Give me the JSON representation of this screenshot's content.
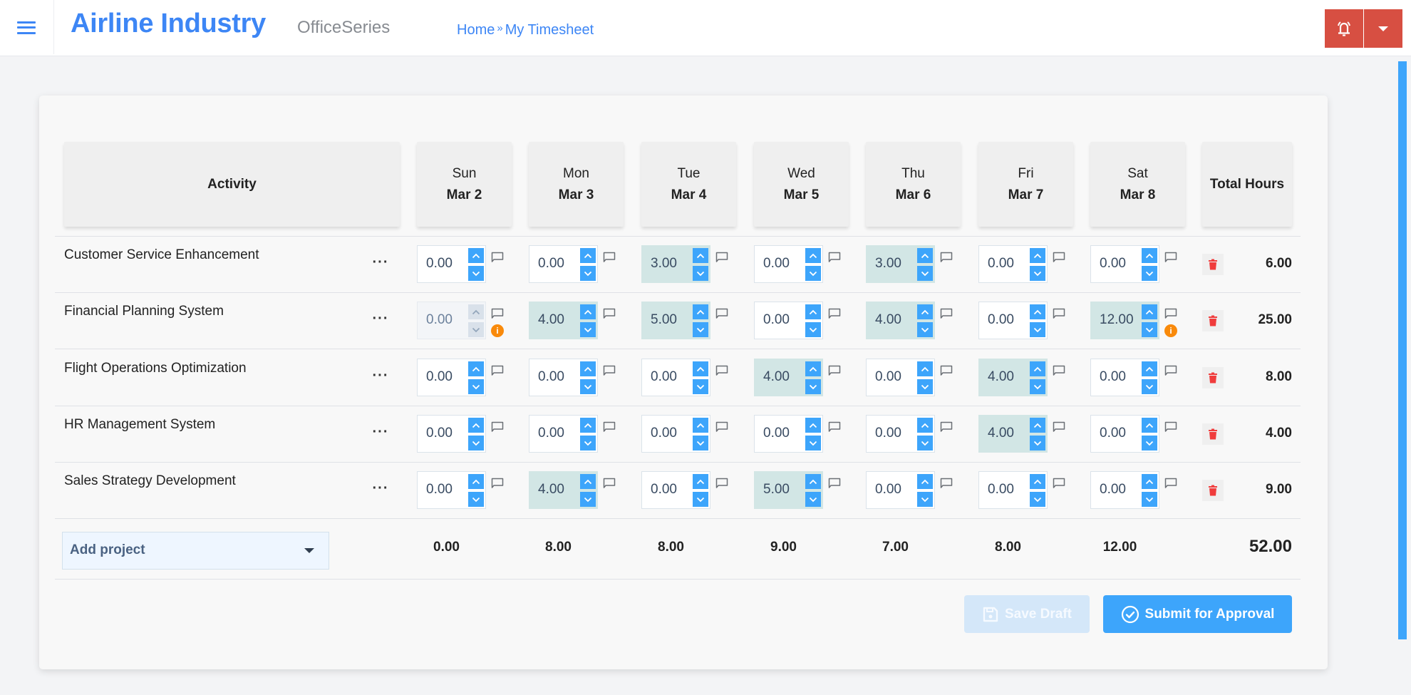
{
  "header": {
    "menu_icon": "hamburger-icon",
    "brand": "Airline Industry",
    "product": "OfficeSeries",
    "breadcrumb": [
      {
        "label": "Home"
      },
      {
        "label": "My Timesheet"
      }
    ],
    "breadcrumb_separator": "»",
    "notification_icon": "bell-icon",
    "dropdown_icon": "caret-down-icon",
    "accent_color": "#3d86f5",
    "alert_color": "#d74f42"
  },
  "timesheet": {
    "activity_header": "Activity",
    "total_header": "Total Hours",
    "days": [
      {
        "day": "Sun",
        "date": "Mar 2"
      },
      {
        "day": "Mon",
        "date": "Mar 3"
      },
      {
        "day": "Tue",
        "date": "Mar 4"
      },
      {
        "day": "Wed",
        "date": "Mar 5"
      },
      {
        "day": "Thu",
        "date": "Mar 6"
      },
      {
        "day": "Fri",
        "date": "Mar 7"
      },
      {
        "day": "Sat",
        "date": "Mar 8"
      }
    ],
    "more_label": "···",
    "rows": [
      {
        "activity": "Customer Service Enhancement",
        "hours": [
          "0.00",
          "0.00",
          "3.00",
          "0.00",
          "3.00",
          "0.00",
          "0.00"
        ],
        "disabled": [
          false,
          false,
          false,
          false,
          false,
          false,
          false
        ],
        "warnings": [
          false,
          false,
          false,
          false,
          false,
          false,
          false
        ],
        "total": "6.00"
      },
      {
        "activity": "Financial Planning System",
        "hours": [
          "0.00",
          "4.00",
          "5.00",
          "0.00",
          "4.00",
          "0.00",
          "12.00"
        ],
        "disabled": [
          true,
          false,
          false,
          false,
          false,
          false,
          false
        ],
        "warnings": [
          true,
          false,
          false,
          false,
          false,
          false,
          true
        ],
        "total": "25.00"
      },
      {
        "activity": "Flight Operations Optimization",
        "hours": [
          "0.00",
          "0.00",
          "0.00",
          "4.00",
          "0.00",
          "4.00",
          "0.00"
        ],
        "disabled": [
          false,
          false,
          false,
          false,
          false,
          false,
          false
        ],
        "warnings": [
          false,
          false,
          false,
          false,
          false,
          false,
          false
        ],
        "total": "8.00"
      },
      {
        "activity": "HR Management System",
        "hours": [
          "0.00",
          "0.00",
          "0.00",
          "0.00",
          "0.00",
          "4.00",
          "0.00"
        ],
        "disabled": [
          false,
          false,
          false,
          false,
          false,
          false,
          false
        ],
        "warnings": [
          false,
          false,
          false,
          false,
          false,
          false,
          false
        ],
        "total": "4.00"
      },
      {
        "activity": "Sales Strategy Development",
        "hours": [
          "0.00",
          "4.00",
          "0.00",
          "5.00",
          "0.00",
          "0.00",
          "0.00"
        ],
        "disabled": [
          false,
          false,
          false,
          false,
          false,
          false,
          false
        ],
        "warnings": [
          false,
          false,
          false,
          false,
          false,
          false,
          false
        ],
        "total": "9.00"
      }
    ],
    "day_totals": [
      "0.00",
      "8.00",
      "8.00",
      "9.00",
      "7.00",
      "8.00",
      "12.00"
    ],
    "grand_total": "52.00",
    "add_project_label": "Add project",
    "info_glyph": "i"
  },
  "actions": {
    "save_draft": "Save Draft",
    "save_draft_enabled": false,
    "submit": "Submit for Approval",
    "primary_color": "#3da5fb"
  }
}
